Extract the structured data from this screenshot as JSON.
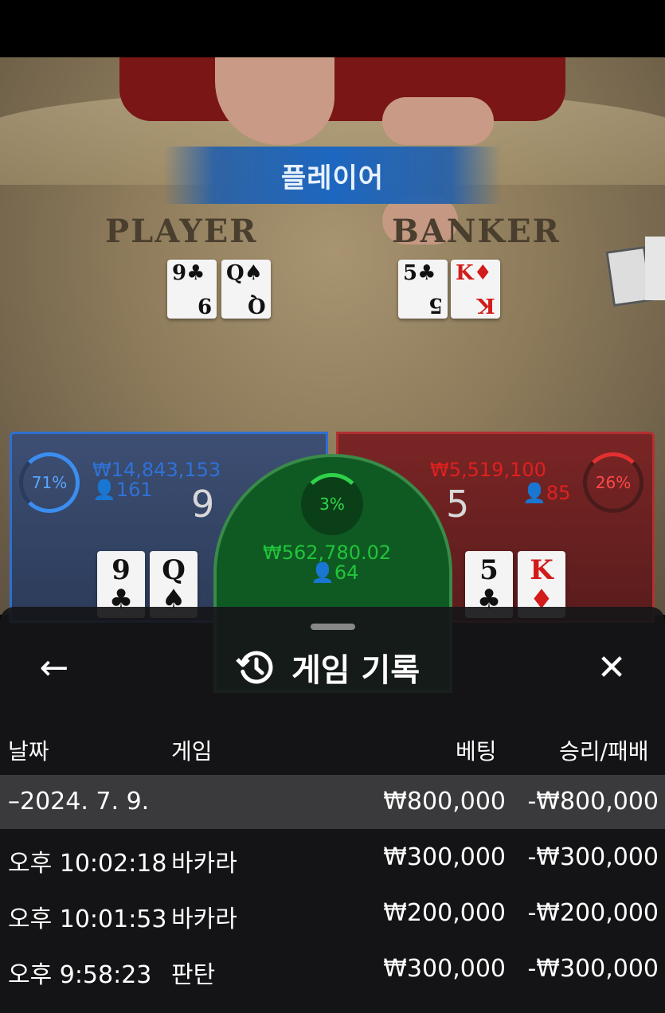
{
  "scene": {
    "banner": "플레이어",
    "felt_labels": {
      "player": "PLAYER",
      "banker": "BANKER"
    },
    "table_cards": {
      "player": [
        {
          "rank": "9",
          "suit": "♣"
        },
        {
          "rank": "Q",
          "suit": "♠"
        }
      ],
      "banker": [
        {
          "rank": "5",
          "suit": "♣"
        },
        {
          "rank": "K",
          "suit": "♦"
        }
      ]
    }
  },
  "bets": {
    "player": {
      "percent": "71%",
      "amount": "₩14,843,153",
      "players": "161",
      "score": "9",
      "cards": [
        {
          "rank": "9",
          "suit": "♣"
        },
        {
          "rank": "Q",
          "suit": "♠"
        }
      ]
    },
    "banker": {
      "percent": "26%",
      "amount": "₩5,519,100",
      "players": "85",
      "score": "5",
      "cards": [
        {
          "rank": "5",
          "suit": "♣"
        },
        {
          "rank": "K",
          "suit": "♦"
        }
      ]
    },
    "tie": {
      "percent": "3%",
      "amount": "₩562,780.02",
      "players": "64"
    }
  },
  "history_sheet": {
    "title": "게임 기록",
    "icons": {
      "back": "arrow-left-icon",
      "history": "history-icon",
      "close": "close-icon"
    },
    "columns": {
      "date": "날짜",
      "game": "게임",
      "bet": "베팅",
      "result": "승리/패배"
    },
    "date_group": {
      "date": "–2024. 7. 9.",
      "bet": "₩800,000",
      "result": "-₩800,000"
    },
    "rows": [
      {
        "time": "오후 10:02:18",
        "game": "바카라",
        "bet": "₩300,000",
        "result": "-₩300,000"
      },
      {
        "time": "오후 10:01:53",
        "game": "바카라",
        "bet": "₩200,000",
        "result": "-₩200,000"
      },
      {
        "time": "오후 9:58:23",
        "game": "판탄",
        "bet": "₩300,000",
        "result": "-₩300,000"
      }
    ]
  }
}
